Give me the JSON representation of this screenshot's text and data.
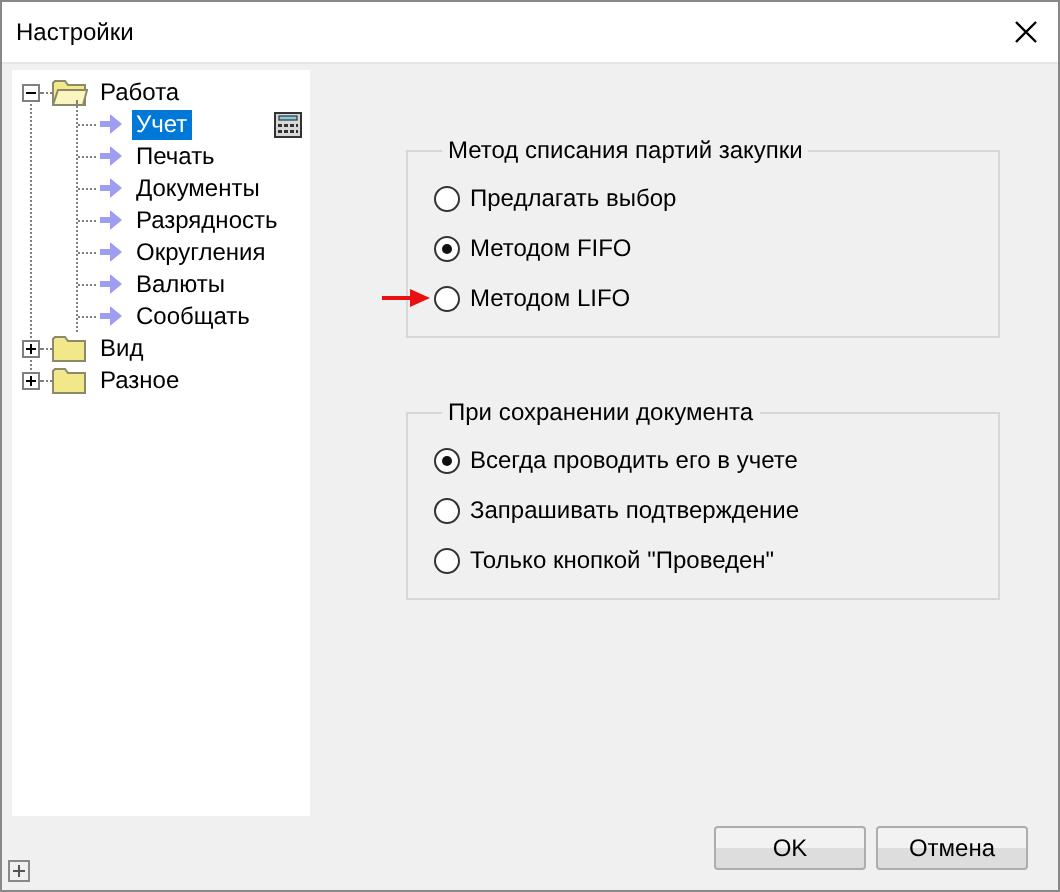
{
  "window": {
    "title": "Настройки"
  },
  "tree": [
    {
      "label": "Работа",
      "expanded": true,
      "children": [
        {
          "label": "Учет",
          "selected": true
        },
        {
          "label": "Печать",
          "selected": false
        },
        {
          "label": "Документы",
          "selected": false
        },
        {
          "label": "Разрядность",
          "selected": false
        },
        {
          "label": "Округления",
          "selected": false
        },
        {
          "label": "Валюты",
          "selected": false
        },
        {
          "label": "Сообщать",
          "selected": false
        }
      ]
    },
    {
      "label": "Вид",
      "expanded": false
    },
    {
      "label": "Разное",
      "expanded": false
    }
  ],
  "groups": [
    {
      "title": "Метод списания партий закупки",
      "options": [
        {
          "label": "Предлагать выбор",
          "selected": false,
          "marked": false
        },
        {
          "label": "Методом FIFO",
          "selected": true,
          "marked": false
        },
        {
          "label": "Методом LIFO",
          "selected": false,
          "marked": true
        }
      ]
    },
    {
      "title": "При сохранении документа",
      "options": [
        {
          "label": "Всегда проводить его в учете",
          "selected": true,
          "marked": false
        },
        {
          "label": "Запрашивать подтверждение",
          "selected": false,
          "marked": false
        },
        {
          "label": "Только кнопкой \"Проведен\"",
          "selected": false,
          "marked": false
        }
      ]
    }
  ],
  "buttons": [
    "OK",
    "Отмена"
  ]
}
